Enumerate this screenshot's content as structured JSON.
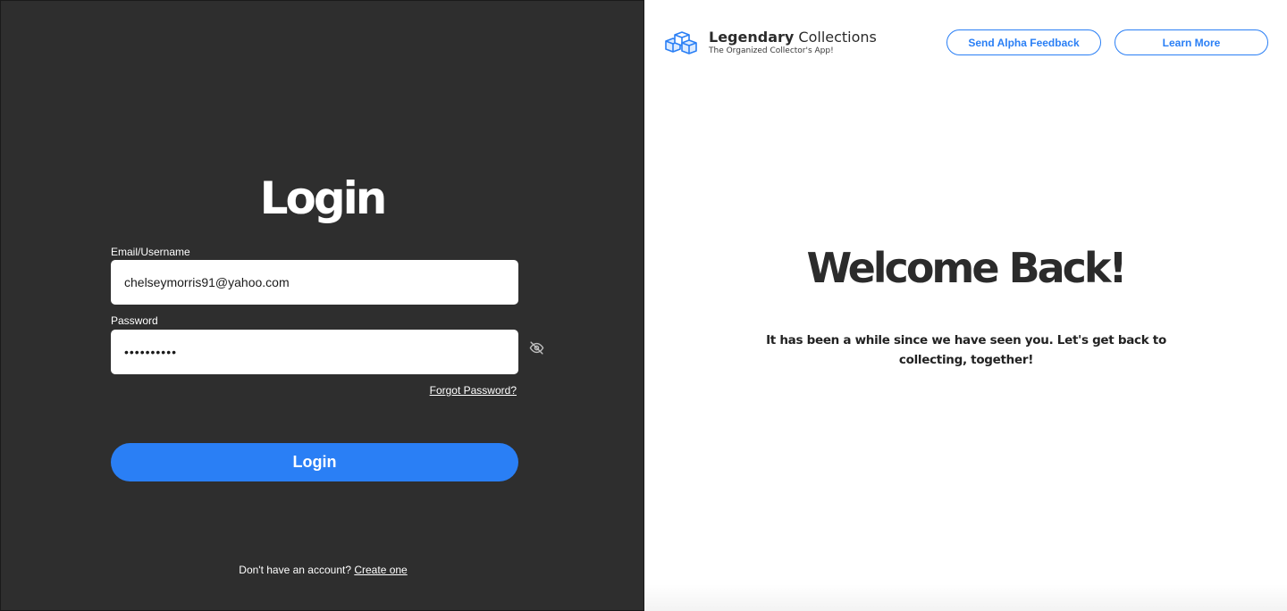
{
  "login": {
    "title": "Login",
    "email_label": "Email/Username",
    "email_value": "chelseymorris91@yahoo.com",
    "password_label": "Password",
    "password_value": "••••••••••",
    "password_toggle_icon": "eye-slash-icon",
    "forgot_link": "Forgot Password?",
    "submit_label": "Login",
    "no_account_text": "Don't have an account?",
    "create_link": "Create one",
    "accent_color": "#2a7ff5"
  },
  "brand": {
    "name_bold": "Legendary",
    "name_regular": "Collections",
    "tagline": "The Organized Collector's App!",
    "logo_icon": "stacked-cubes-icon"
  },
  "header": {
    "feedback_button": "Send Alpha Feedback",
    "learn_more_button": "Learn More"
  },
  "welcome": {
    "title": "Welcome Back!",
    "subtitle": "It has been a while since we have seen you. Let's get back to collecting, together!"
  }
}
